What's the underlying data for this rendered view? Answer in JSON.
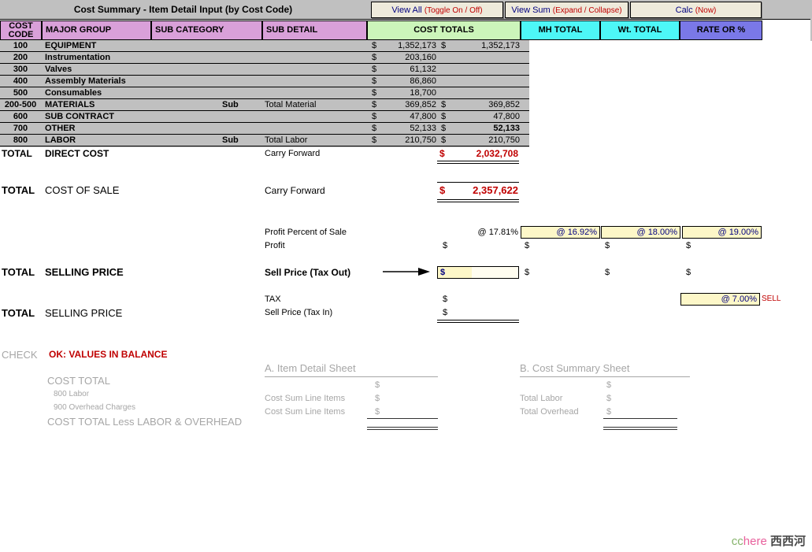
{
  "titlebar": {
    "title": "Cost Summary - Item Detail Input (by Cost Code)",
    "buttons": [
      {
        "name": "view-all",
        "label": "View All",
        "sub": "(Toggle On / Off)"
      },
      {
        "name": "view-sum",
        "label": "View Sum",
        "sub": "(Expand / Collapse)"
      },
      {
        "name": "calc-now",
        "label": "Calc",
        "sub": "(Now)"
      }
    ]
  },
  "columns": [
    {
      "label": "COST CODE",
      "line1": "COST",
      "line2": "CODE"
    },
    {
      "label": "MAJOR GROUP"
    },
    {
      "label": "SUB CATEGORY"
    },
    {
      "label": "SUB DETAIL"
    },
    {
      "label": "COST TOTALS"
    },
    {
      "label": "MH TOTAL"
    },
    {
      "label": "Wt. TOTAL"
    },
    {
      "label": "RATE OR %"
    }
  ],
  "rows": [
    {
      "code": "100",
      "group": "EQUIPMENT",
      "subcat": "",
      "subdetail": "",
      "c1_sign": "$",
      "c1": "1,352,173",
      "c2_sign": "$",
      "c2": "1,352,173",
      "c2_bold": false
    },
    {
      "code": "200",
      "group": "Instrumentation",
      "subcat": "",
      "subdetail": "",
      "c1_sign": "$",
      "c1": "203,160",
      "c2_sign": "",
      "c2": "",
      "c2_bold": false
    },
    {
      "code": "300",
      "group": "Valves",
      "subcat": "",
      "subdetail": "",
      "c1_sign": "$",
      "c1": "61,132",
      "c2_sign": "",
      "c2": "",
      "c2_bold": false
    },
    {
      "code": "400",
      "group": "Assembly Materials",
      "subcat": "",
      "subdetail": "",
      "c1_sign": "$",
      "c1": "86,860",
      "c2_sign": "",
      "c2": "",
      "c2_bold": false
    },
    {
      "code": "500",
      "group": "Consumables",
      "subcat": "",
      "subdetail": "",
      "c1_sign": "$",
      "c1": "18,700",
      "c2_sign": "",
      "c2": "",
      "c2_bold": false
    },
    {
      "code": "200-500",
      "group": "MATERIALS",
      "subcat": "Sub",
      "subdetail": "Total Material",
      "c1_sign": "$",
      "c1": "369,852",
      "c2_sign": "$",
      "c2": "369,852",
      "c2_bold": false
    },
    {
      "code": "600",
      "group": "SUB CONTRACT",
      "subcat": "",
      "subdetail": "",
      "c1_sign": "$",
      "c1": "47,800",
      "c2_sign": "$",
      "c2": "47,800",
      "c2_bold": false
    },
    {
      "code": "700",
      "group": "OTHER",
      "subcat": "",
      "subdetail": "",
      "c1_sign": "$",
      "c1": "52,133",
      "c2_sign": "$",
      "c2": "52,133",
      "c2_bold": true
    },
    {
      "code": "800",
      "group": "LABOR",
      "subcat": "Sub",
      "subdetail": "Total Labor",
      "c1_sign": "$",
      "c1": "210,750",
      "c2_sign": "$",
      "c2": "210,750",
      "c2_bold": false
    }
  ],
  "direct_cost": {
    "total_label": "TOTAL",
    "name": "DIRECT COST",
    "desc": "Carry Forward",
    "sign": "$",
    "value": "2,032,708"
  },
  "cost_of_sale": {
    "total_label": "TOTAL",
    "name": "COST OF SALE",
    "desc": "Carry Forward",
    "sign": "$",
    "value": "2,357,622"
  },
  "profit": {
    "percent_label": "Profit Percent of Sale",
    "profit_label": "Profit",
    "base_percent": "@ 17.81%",
    "cells": [
      {
        "at": "@",
        "pct": "16.92%"
      },
      {
        "at": "@",
        "pct": "18.00%"
      },
      {
        "at": "@",
        "pct": "19.00%"
      }
    ],
    "dollar_signs": [
      "$",
      "$",
      "$",
      "$"
    ]
  },
  "selling_price": {
    "total_label": "TOTAL",
    "name": "SELLING PRICE",
    "desc": "Sell Price (Tax Out)",
    "input_sign": "$",
    "input_value": "",
    "dollar_signs": [
      "$",
      "$",
      "$"
    ]
  },
  "tax": {
    "tax_label": "TAX",
    "tax_sign": "$",
    "sell_in_total_label": "TOTAL",
    "sell_in_name": "SELLING PRICE",
    "sell_in_label": "Sell Price (Tax In)",
    "sell_in_sign": "$",
    "rate_at": "@",
    "rate_pct": "7.00%",
    "rate_suffix": "SELL"
  },
  "check": {
    "word": "CHECK",
    "status": "OK: VALUES IN BALANCE",
    "left_items": [
      {
        "label": "COST TOTAL",
        "size": "lg"
      },
      {
        "label": "800  Labor",
        "size": "sm"
      },
      {
        "label": "900  Overhead Charges",
        "size": "sm"
      },
      {
        "label": "COST TOTAL Less LABOR & OVERHEAD",
        "size": "lg"
      }
    ],
    "panel_a": {
      "title": "A. Item Detail Sheet",
      "rows": [
        {
          "label": "",
          "sign": "$"
        },
        {
          "label": "Cost Sum Line Items",
          "sign": "$"
        },
        {
          "label": "Cost Sum Line Items",
          "sign": "$"
        }
      ]
    },
    "panel_b": {
      "title": "B. Cost Summary Sheet",
      "rows": [
        {
          "label": "",
          "sign": "$"
        },
        {
          "label": "Total Labor",
          "sign": "$"
        },
        {
          "label": "Total Overhead",
          "sign": "$"
        }
      ]
    }
  },
  "watermark": {
    "cc": "cc",
    "here": "here",
    "cn": "西西河"
  },
  "colors": {
    "header_pink": "#d9a0d9",
    "header_green": "#ccf5ba",
    "header_cyan": "#4df7f7",
    "header_violet": "#7a78e8",
    "data_gray": "#c0c0c0",
    "total_red": "#c00000",
    "input_yellow": "#fdf7c8",
    "input_text_blue": "#000080",
    "check_gray": "#a6a6a6"
  }
}
